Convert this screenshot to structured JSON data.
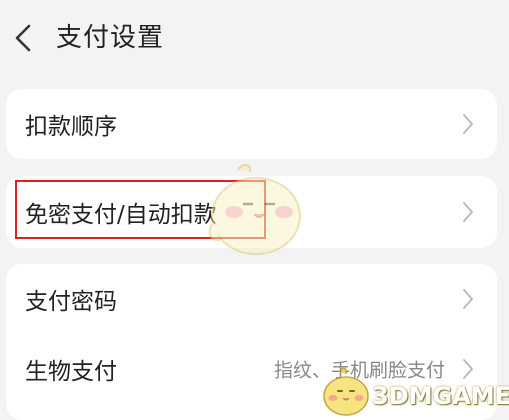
{
  "header": {
    "title": "支付设置",
    "back_icon": "chevron-left-icon"
  },
  "groups": [
    {
      "rows": [
        {
          "label": "扣款顺序",
          "value": ""
        }
      ]
    },
    {
      "rows": [
        {
          "label": "免密支付/自动扣款",
          "value": ""
        }
      ]
    },
    {
      "rows": [
        {
          "label": "支付密码",
          "value": ""
        },
        {
          "label": "生物支付",
          "value": "指纹、手机刷脸支付"
        }
      ]
    }
  ],
  "highlight": {
    "color": "#e02020",
    "target": "免密支付/自动扣款"
  },
  "watermark": {
    "text": "3DMGAME",
    "icon": "mascot-logo"
  },
  "colors": {
    "background": "#f3f3f3",
    "card": "#ffffff",
    "chevron": "#b8b8b8",
    "secondary_text": "#888888"
  }
}
